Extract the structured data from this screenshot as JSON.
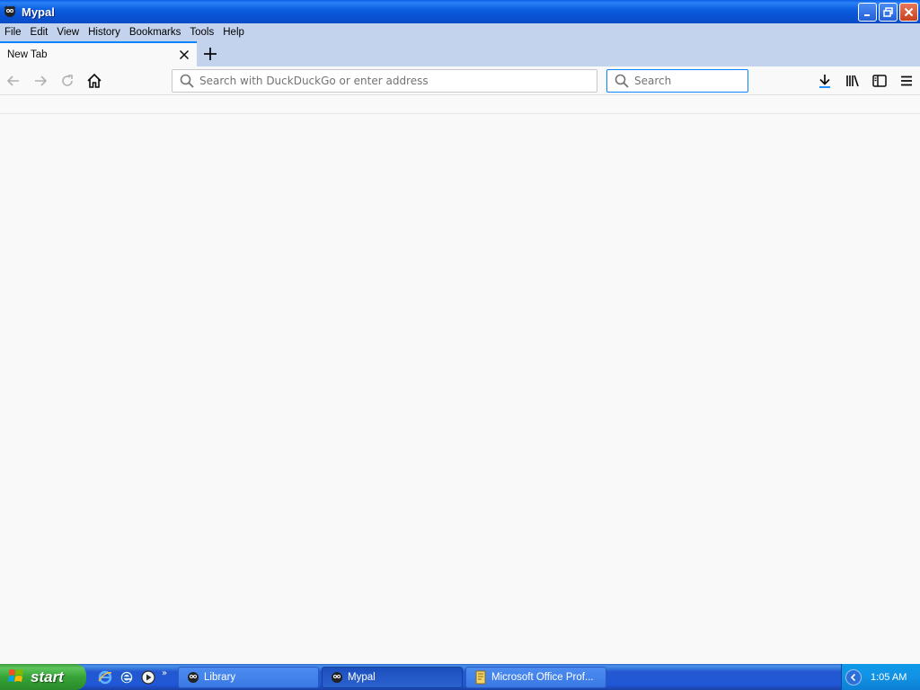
{
  "window": {
    "title": "Mypal"
  },
  "menubar": {
    "items": [
      {
        "label": "File"
      },
      {
        "label": "Edit"
      },
      {
        "label": "View"
      },
      {
        "label": "History"
      },
      {
        "label": "Bookmarks"
      },
      {
        "label": "Tools"
      },
      {
        "label": "Help"
      }
    ]
  },
  "tabs": [
    {
      "label": "New Tab",
      "active": true
    }
  ],
  "navbar": {
    "url_placeholder": "Search with DuckDuckGo or enter address",
    "url_value": "",
    "search_placeholder": "Search",
    "search_value": ""
  },
  "taskbar": {
    "start_label": "start",
    "tasks": [
      {
        "label": "Library",
        "active": false
      },
      {
        "label": "Mypal",
        "active": true
      },
      {
        "label": "Microsoft Office Prof...",
        "active": false
      }
    ],
    "clock": "1:05 AM"
  },
  "colors": {
    "accent": "#0a84ff",
    "titlebar": "#0a5fe6",
    "menubar": "#c3d3ed",
    "taskbar": "#2458d2",
    "start": "#37a437"
  }
}
